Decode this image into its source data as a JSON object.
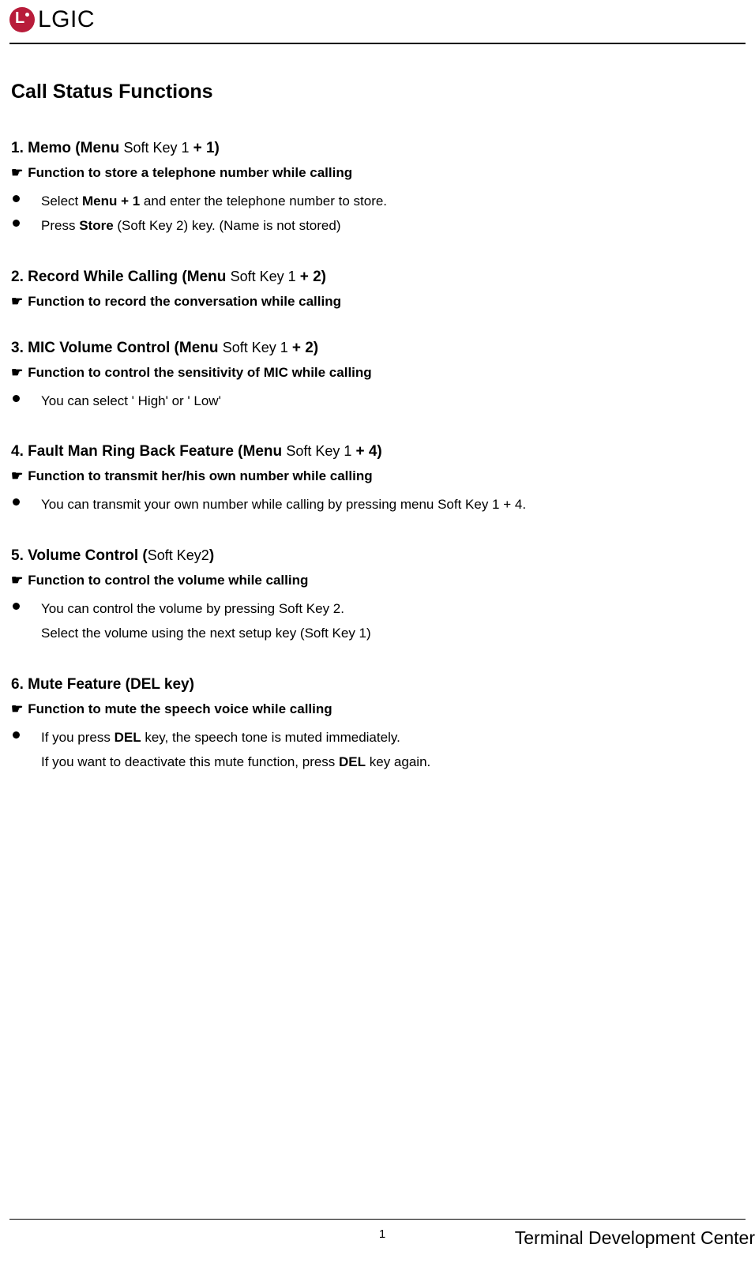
{
  "header": {
    "logo_text": "LGIC"
  },
  "title": "Call Status Functions",
  "sections": [
    {
      "num": "1.",
      "title_bold_a": "Memo (Menu ",
      "title_normal": "Soft Key 1 ",
      "title_bold_b": "+ 1)",
      "func": "Function to store a telephone number while calling",
      "items": [
        {
          "pre": "Select ",
          "bold": "Menu + 1",
          "post": " and enter the telephone number to store.",
          "dot": true
        },
        {
          "pre": "Press ",
          "bold": "Store",
          "post": " (Soft Key 2) key. (Name is not stored)",
          "dot": true
        }
      ]
    },
    {
      "num": "2.",
      "title_bold_a": "Record While Calling (Menu ",
      "title_normal": "Soft Key 1 ",
      "title_bold_b": "+ 2)",
      "func": "Function to record the conversation while calling",
      "items": []
    },
    {
      "num": "3.",
      "title_bold_a": "MIC Volume Control (Menu ",
      "title_normal": "Soft Key 1 ",
      "title_bold_b": "+ 2)",
      "func": "Function to control the sensitivity of MIC while calling",
      "items": [
        {
          "pre": "You can select ' High'  or ' Low'",
          "bold": "",
          "post": "",
          "dot": true
        }
      ]
    },
    {
      "num": "4.",
      "title_bold_a": "Fault Man Ring Back Feature (Menu ",
      "title_normal": "Soft Key 1 ",
      "title_bold_b": "+ 4)",
      "func": "Function to transmit her/his own number while calling",
      "items": [
        {
          "pre": "You can transmit your own number while calling by pressing menu Soft Key 1 + 4.",
          "bold": "",
          "post": "",
          "dot": true
        }
      ]
    },
    {
      "num": "5.",
      "title_bold_a": "Volume Control (",
      "title_normal": "Soft Key2",
      "title_bold_b": ")",
      "func": "Function to control the volume while calling",
      "items": [
        {
          "pre": "You can control the volume by pressing Soft Key 2.",
          "bold": "",
          "post": "",
          "dot": true
        },
        {
          "pre": "Select the volume using the next setup key (Soft Key 1)",
          "bold": "",
          "post": "",
          "dot": false
        }
      ]
    },
    {
      "num": "6.",
      "title_bold_a": "Mute Feature (DEL key)",
      "title_normal": "",
      "title_bold_b": "",
      "func": "Function to mute the speech voice while calling",
      "items": [
        {
          "pre": "If you press ",
          "bold": "DEL",
          "post": " key, the speech tone is muted immediately.",
          "dot": true
        },
        {
          "pre": "If you want to deactivate this mute function, press ",
          "bold": "DEL",
          "post": " key again.",
          "dot": false
        }
      ]
    }
  ],
  "footer": {
    "page": "1",
    "text": "Terminal Development Center"
  },
  "pointer_glyph": "☛"
}
